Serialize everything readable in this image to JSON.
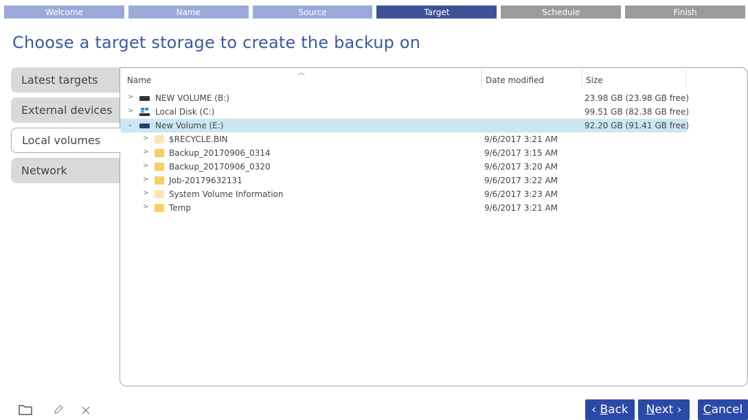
{
  "wizard_steps": [
    {
      "label": "Welcome",
      "state": "done"
    },
    {
      "label": "Name",
      "state": "done"
    },
    {
      "label": "Source",
      "state": "done"
    },
    {
      "label": "Target",
      "state": "active"
    },
    {
      "label": "Schedule",
      "state": "todo"
    },
    {
      "label": "Finish",
      "state": "todo"
    }
  ],
  "page_title": "Choose a target storage to create the backup on",
  "tabs": [
    {
      "label": "Latest targets",
      "selected": false
    },
    {
      "label": "External devices",
      "selected": false
    },
    {
      "label": "Local volumes",
      "selected": true
    },
    {
      "label": "Network",
      "selected": false
    }
  ],
  "columns": {
    "name": "Name",
    "date_modified": "Date modified",
    "size": "Size"
  },
  "tree": [
    {
      "name": "NEW VOLUME (B:)",
      "date": "",
      "size": "23.98 GB (23.98 GB free)",
      "icon": "drive-icon",
      "level": 0,
      "expanded": false,
      "selected": false
    },
    {
      "name": "Local Disk (C:)",
      "date": "",
      "size": "99.51 GB (82.38 GB free)",
      "icon": "windows-drive-icon",
      "level": 0,
      "expanded": false,
      "selected": false
    },
    {
      "name": "New Volume (E:)",
      "date": "",
      "size": "92.20 GB (91.41 GB free)",
      "icon": "drive-icon",
      "level": 0,
      "expanded": true,
      "selected": true
    },
    {
      "name": "$RECYCLE.BIN",
      "date": "9/6/2017 3:21 AM",
      "size": "",
      "icon": "folder-pale-icon",
      "level": 1,
      "expanded": false,
      "selected": false
    },
    {
      "name": "Backup_20170906_0314",
      "date": "9/6/2017 3:15 AM",
      "size": "",
      "icon": "folder-icon",
      "level": 1,
      "expanded": false,
      "selected": false
    },
    {
      "name": "Backup_20170906_0320",
      "date": "9/6/2017 3:20 AM",
      "size": "",
      "icon": "folder-icon",
      "level": 1,
      "expanded": false,
      "selected": false
    },
    {
      "name": "Job-20179632131",
      "date": "9/6/2017 3:22 AM",
      "size": "",
      "icon": "folder-icon",
      "level": 1,
      "expanded": false,
      "selected": false
    },
    {
      "name": "System Volume Information",
      "date": "9/6/2017 3:23 AM",
      "size": "",
      "icon": "folder-pale-icon",
      "level": 1,
      "expanded": false,
      "selected": false
    },
    {
      "name": "Temp",
      "date": "9/6/2017 3:21 AM",
      "size": "",
      "icon": "folder-icon",
      "level": 1,
      "expanded": false,
      "selected": false
    }
  ],
  "toolbar_icons": [
    "new-folder-icon",
    "rename-icon",
    "delete-icon"
  ],
  "buttons": {
    "back_prefix": "‹ ",
    "back_key": "B",
    "back_rest": "ack",
    "next_key": "N",
    "next_rest": "ext",
    "next_suffix": " ›",
    "cancel_key": "C",
    "cancel_rest": "ancel"
  },
  "colors": {
    "accent": "#2b4aa8",
    "title": "#3a5aa1",
    "step_done": "#9ba9d9",
    "step_active": "#3d5296",
    "step_todo": "#9b9b9b",
    "selection": "#cce6f4"
  }
}
